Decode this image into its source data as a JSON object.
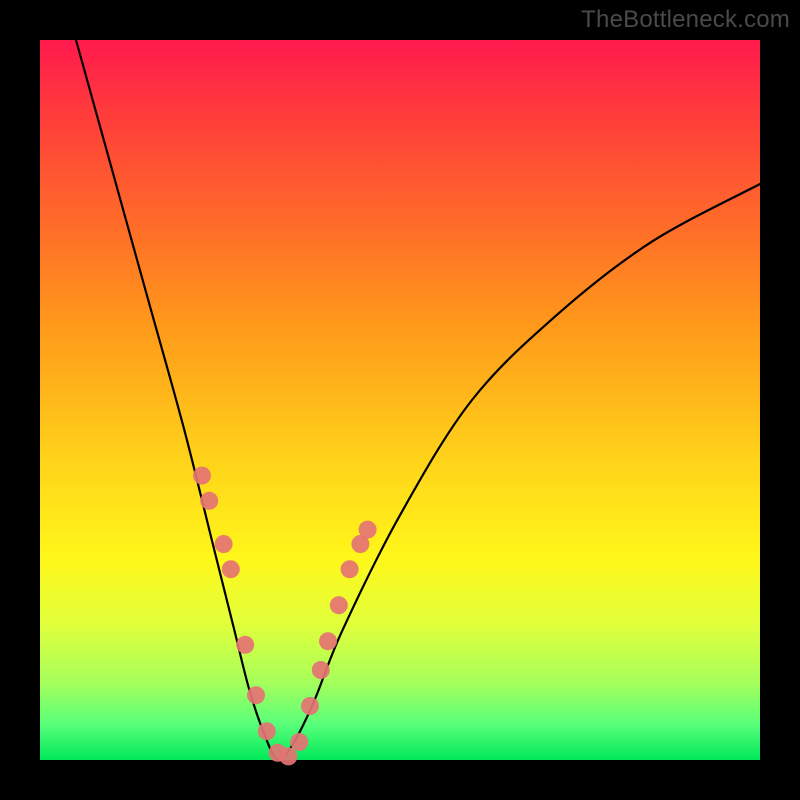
{
  "watermark": "TheBottleneck.com",
  "chart_data": {
    "type": "line",
    "title": "",
    "xlabel": "",
    "ylabel": "",
    "xlim": [
      0,
      1
    ],
    "ylim": [
      0,
      1
    ],
    "series": [
      {
        "name": "bottleneck-curve",
        "x": [
          0.05,
          0.1,
          0.15,
          0.2,
          0.24,
          0.27,
          0.29,
          0.31,
          0.33,
          0.35,
          0.38,
          0.42,
          0.5,
          0.6,
          0.72,
          0.85,
          1.0
        ],
        "y": [
          1.0,
          0.82,
          0.64,
          0.46,
          0.3,
          0.18,
          0.1,
          0.04,
          0.0,
          0.02,
          0.08,
          0.18,
          0.34,
          0.5,
          0.62,
          0.72,
          0.8
        ]
      }
    ],
    "highlighted_points": {
      "name": "marked-points",
      "color": "#e57373",
      "x": [
        0.225,
        0.235,
        0.255,
        0.265,
        0.285,
        0.3,
        0.315,
        0.33,
        0.345,
        0.36,
        0.375,
        0.39,
        0.4,
        0.415,
        0.43,
        0.445,
        0.455
      ],
      "y": [
        0.395,
        0.36,
        0.3,
        0.265,
        0.16,
        0.09,
        0.04,
        0.01,
        0.005,
        0.025,
        0.075,
        0.125,
        0.165,
        0.215,
        0.265,
        0.3,
        0.32
      ]
    },
    "gradient_stops": [
      {
        "pos": 0.0,
        "color": "#ff1a4d"
      },
      {
        "pos": 0.25,
        "color": "#ff6a2a"
      },
      {
        "pos": 0.58,
        "color": "#ffd21a"
      },
      {
        "pos": 0.81,
        "color": "#e1ff3a"
      },
      {
        "pos": 1.0,
        "color": "#00e85a"
      }
    ]
  }
}
